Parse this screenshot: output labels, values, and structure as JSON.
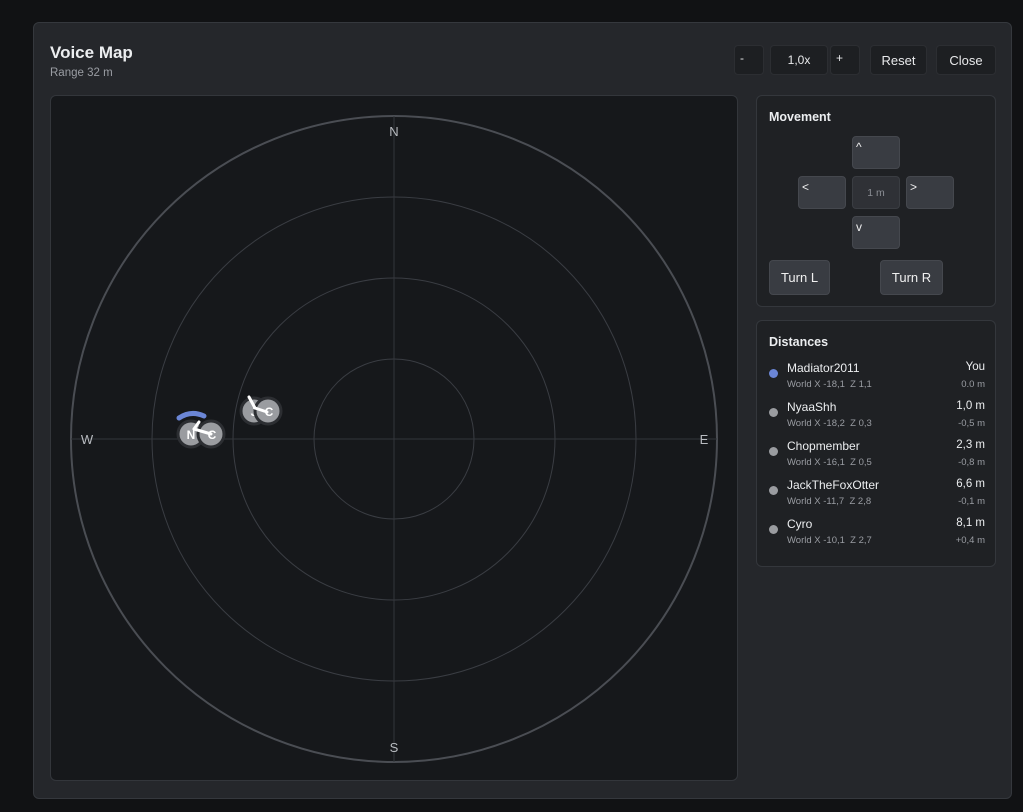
{
  "header": {
    "title": "Voice Map",
    "subtitle": "Range 32 m"
  },
  "toolbar": {
    "zoom_out_label": "-",
    "zoom_level": "1,0x",
    "zoom_in_label": "+",
    "reset_label": "Reset",
    "close_label": "Close"
  },
  "map": {
    "compass": {
      "north": "N",
      "south": "S",
      "east": "E",
      "west": "W"
    },
    "rings": 4,
    "self_color": "#6b86d6",
    "marker_color": "#9a9ca0",
    "markers": [
      {
        "initial": "N",
        "player": "NyaaShh"
      },
      {
        "initial": "C",
        "player": "Chopmember"
      },
      {
        "initial": "J",
        "player": "JackTheFoxOtter"
      },
      {
        "initial": "C",
        "player": "Cyro"
      }
    ]
  },
  "movement": {
    "title": "Movement",
    "up_label": "^",
    "left_label": "<",
    "step_label": "1 m",
    "right_label": ">",
    "down_label": "v",
    "turn_left_label": "Turn L",
    "turn_right_label": "Turn R"
  },
  "distances": {
    "title": "Distances",
    "players": [
      {
        "name": "Madiator2011",
        "world": "World X -18,1  Z 1,1",
        "distance": "You",
        "delta": "0.0 m",
        "color": "#6b86d6"
      },
      {
        "name": "NyaaShh",
        "world": "World X -18,2  Z 0,3",
        "distance": "1,0 m",
        "delta": "-0,5 m",
        "color": "#9a9ca0"
      },
      {
        "name": "Chopmember",
        "world": "World X -16,1  Z 0,5",
        "distance": "2,3 m",
        "delta": "-0,8 m",
        "color": "#9a9ca0"
      },
      {
        "name": "JackTheFoxOtter",
        "world": "World X -11,7  Z 2,8",
        "distance": "6,6 m",
        "delta": "-0,1 m",
        "color": "#9a9ca0"
      },
      {
        "name": "Cyro",
        "world": "World X -10,1  Z 2,7",
        "distance": "8,1 m",
        "delta": "+0,4 m",
        "color": "#9a9ca0"
      }
    ]
  }
}
